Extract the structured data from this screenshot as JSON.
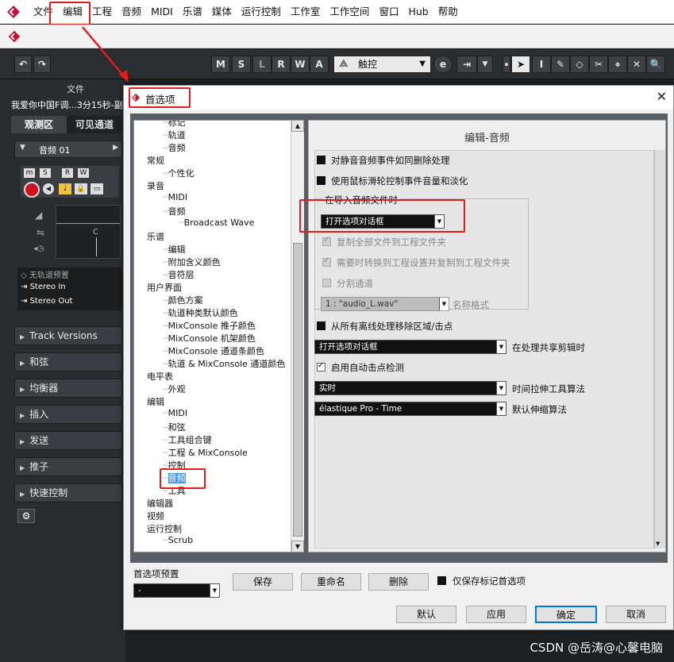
{
  "menubar": {
    "items": [
      "文件",
      "编辑",
      "工程",
      "音频",
      "MIDI",
      "乐谱",
      "媒体",
      "运行控制",
      "工作室",
      "工作空间",
      "窗口",
      "Hub",
      "帮助"
    ]
  },
  "toolbar": {
    "buttons": [
      "M",
      "S",
      "L",
      "R",
      "W",
      "A"
    ],
    "mode": "触控"
  },
  "left": {
    "file_label": "文件",
    "project_name": "我爱你中国F调...3分15秒-副",
    "tabs": [
      "观测区",
      "可见通道"
    ],
    "track_name": "音频 01",
    "track_buttons": [
      "m",
      "S",
      "R",
      "W",
      "⊙"
    ],
    "c_label": "C",
    "routing": [
      "无轨道预置",
      "Stereo In",
      "Stereo Out"
    ],
    "sections": [
      "Track Versions",
      "和弦",
      "均衡器",
      "插入",
      "发送",
      "推子",
      "快速控制"
    ]
  },
  "dialog": {
    "title": "首选项",
    "close": "✕",
    "page_title": "编辑-音频",
    "tree": [
      {
        "label": "标记",
        "level": 2
      },
      {
        "label": "轨道",
        "level": 2
      },
      {
        "label": "音频",
        "level": 2
      },
      {
        "label": "常规",
        "level": 1
      },
      {
        "label": "个性化",
        "level": 2
      },
      {
        "label": "录音",
        "level": 1
      },
      {
        "label": "MIDI",
        "level": 2
      },
      {
        "label": "音频",
        "level": 2
      },
      {
        "label": "Broadcast Wave",
        "level": 3
      },
      {
        "label": "乐谱",
        "level": 1
      },
      {
        "label": "编辑",
        "level": 2
      },
      {
        "label": "附加含义颜色",
        "level": 2
      },
      {
        "label": "音符层",
        "level": 2
      },
      {
        "label": "用户界面",
        "level": 1
      },
      {
        "label": "颜色方案",
        "level": 2
      },
      {
        "label": "轨道种类默认颜色",
        "level": 2
      },
      {
        "label": "MixConsole 推子颜色",
        "level": 2
      },
      {
        "label": "MixConsole 机架颜色",
        "level": 2
      },
      {
        "label": "MixConsole 通道条颜色",
        "level": 2
      },
      {
        "label": "轨道 & MixConsole 通道颜色",
        "level": 2
      },
      {
        "label": "电平表",
        "level": 1
      },
      {
        "label": "外观",
        "level": 2
      },
      {
        "label": "编辑",
        "level": 1
      },
      {
        "label": "MIDI",
        "level": 2
      },
      {
        "label": "和弦",
        "level": 2
      },
      {
        "label": "工具组合键",
        "level": 2
      },
      {
        "label": "工程 & MixConsole",
        "level": 2
      },
      {
        "label": "控制",
        "level": 2
      },
      {
        "label": "音频",
        "level": 2,
        "selected": true
      },
      {
        "label": "工具",
        "level": 2
      },
      {
        "label": "编辑器",
        "level": 1
      },
      {
        "label": "视频",
        "level": 1
      },
      {
        "label": "运行控制",
        "level": 1
      },
      {
        "label": "Scrub",
        "level": 2
      }
    ],
    "options": {
      "opt1": "对静音音频事件如同删除处理",
      "opt2": "使用鼠标滑轮控制事件音量和淡化",
      "group_title": "在导入音频文件时",
      "import_dropdown": "打开选项对话框",
      "sub1": "复制全部文件到工程文件夹",
      "sub2": "需要时转换到工程设置并复制到工程文件夹",
      "sub3": "分割通道",
      "channel_dropdown": "1 : \"audio_L.wav\"",
      "channel_label": "名称格式",
      "opt3": "从所有离线处理移除区域/击点",
      "share_dropdown": "打开选项对话框",
      "share_label": "在处理共享剪辑时",
      "opt4": "启用自动击点检测",
      "stretch_dropdown": "实时",
      "stretch_label": "时间拉伸工具算法",
      "warp_dropdown": "élastique Pro - Time",
      "warp_label": "默认伸缩算法"
    },
    "preset_label": "首选项预置",
    "preset_value": "-",
    "save_btn": "保存",
    "rename_btn": "重命名",
    "delete_btn": "删除",
    "only_marked": "仅保存标记首选项",
    "default_btn": "默认",
    "apply_btn": "应用",
    "ok_btn": "确定",
    "cancel_btn": "取消"
  },
  "watermark": "CSDN @岳涛@心馨电脑",
  "colors": {
    "annotation": "#e81b1b",
    "dark_bg": "#2a2d30"
  }
}
